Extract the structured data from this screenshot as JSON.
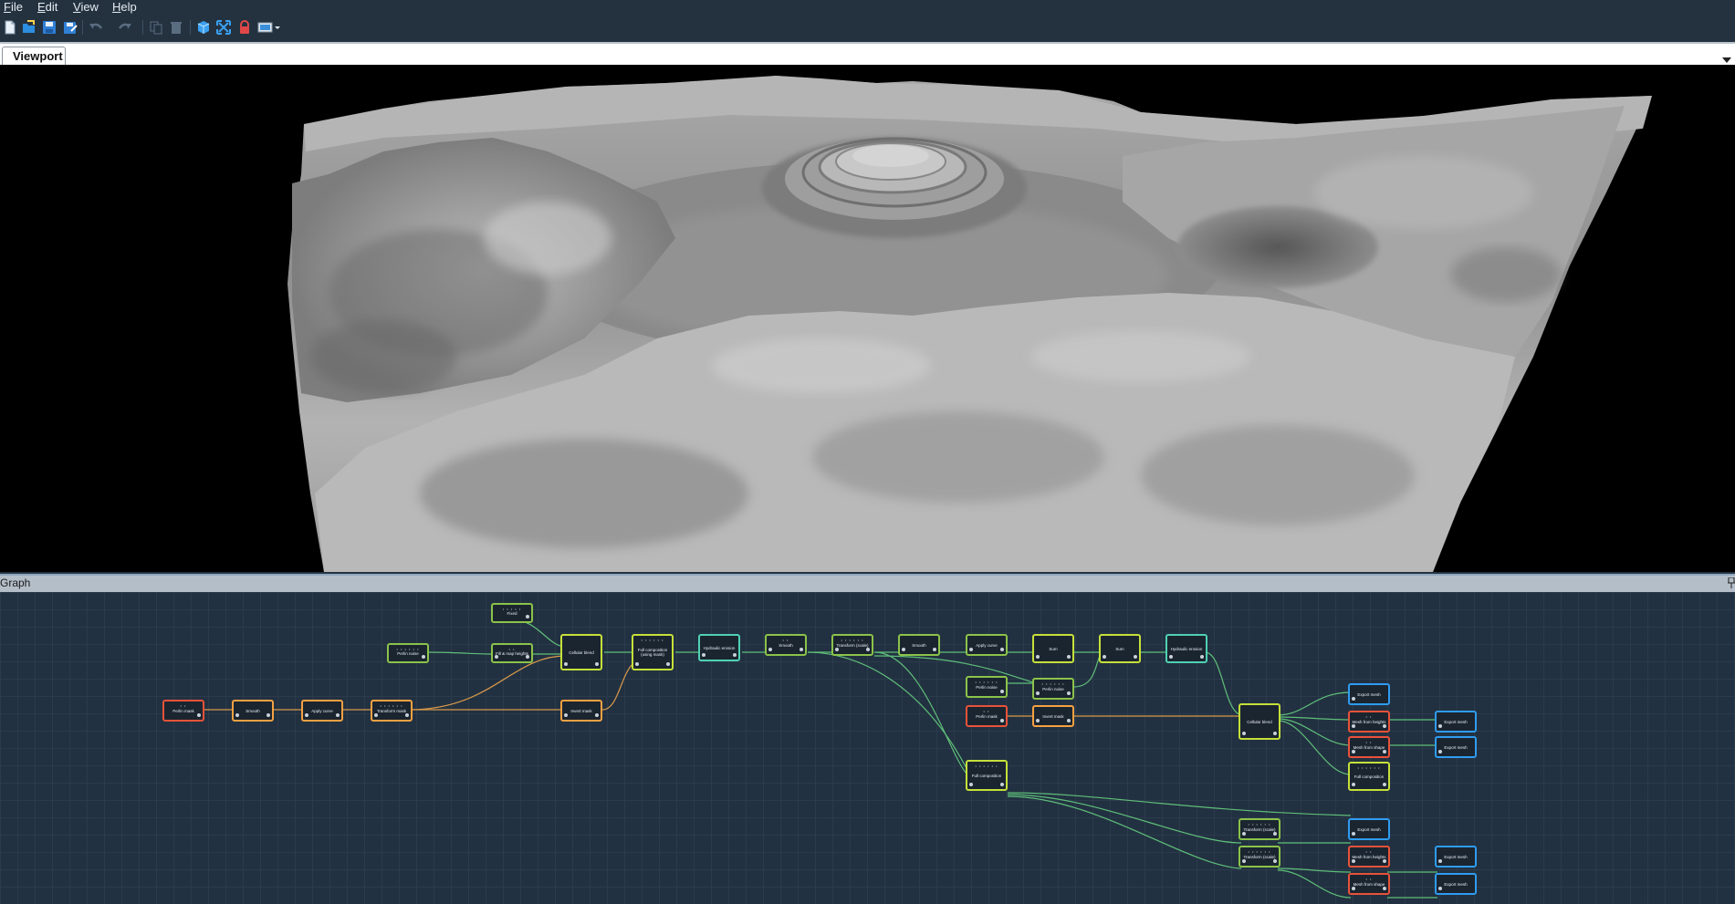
{
  "menu": [
    "File",
    "Edit",
    "View",
    "Help"
  ],
  "toolbar": {
    "icons": [
      "new-icon",
      "open-icon",
      "save-icon",
      "save-as-icon",
      "undo-icon",
      "redo-icon",
      "copy-icon",
      "delete-icon",
      "cube-icon",
      "fullscreen-icon",
      "lock-icon",
      "display-mode-icon"
    ]
  },
  "tabs": {
    "viewport_label": "Viewport"
  },
  "graph": {
    "title": "Graph"
  },
  "colors": {
    "green": "#8bc34a",
    "lime": "#c6e03a",
    "orange": "#f5a142",
    "red": "#e8523a",
    "teal": "#4fd1b4",
    "blue": "#2f9cf0"
  },
  "nodes": [
    {
      "id": "n1",
      "label": "Perlin noise",
      "color": "green",
      "pins": true
    },
    {
      "id": "n2",
      "label": "Fill & map heights",
      "color": "green",
      "pins": true
    },
    {
      "id": "n3",
      "label": "Fixed",
      "color": "green",
      "pins": true
    },
    {
      "id": "n4",
      "label": "Cellular blend",
      "color": "lime",
      "pins": false
    },
    {
      "id": "n5",
      "label": "Full composition (using mask)",
      "color": "lime",
      "pins": true
    },
    {
      "id": "n6",
      "label": "Hydraulic erosion",
      "color": "teal",
      "pins": false
    },
    {
      "id": "n7",
      "label": "Smooth",
      "color": "green",
      "pins": true
    },
    {
      "id": "n8",
      "label": "Transform (scale)",
      "color": "green",
      "pins": true
    },
    {
      "id": "n9",
      "label": "Smooth",
      "color": "green",
      "pins": false
    },
    {
      "id": "n10",
      "label": "Apply curve",
      "color": "green",
      "pins": false
    },
    {
      "id": "n11",
      "label": "Sum",
      "color": "lime",
      "pins": false
    },
    {
      "id": "n12",
      "label": "Sum",
      "color": "lime",
      "pins": false
    },
    {
      "id": "n13",
      "label": "Hydraulic erosion",
      "color": "teal",
      "pins": false
    },
    {
      "id": "n14",
      "label": "Perlin mask",
      "color": "red",
      "pins": true
    },
    {
      "id": "n15",
      "label": "Smooth",
      "color": "orange",
      "pins": false
    },
    {
      "id": "n16",
      "label": "Apply curve",
      "color": "orange",
      "pins": false
    },
    {
      "id": "n17",
      "label": "Transform mask",
      "color": "orange",
      "pins": true
    },
    {
      "id": "n18",
      "label": "Invert mask",
      "color": "orange",
      "pins": false
    },
    {
      "id": "n19",
      "label": "Perlin noise",
      "color": "green",
      "pins": true
    },
    {
      "id": "n20",
      "label": "Perlin noise",
      "color": "green",
      "pins": true
    },
    {
      "id": "n21",
      "label": "Perlin mask",
      "color": "red",
      "pins": true
    },
    {
      "id": "n22",
      "label": "Invert mask",
      "color": "orange",
      "pins": false
    },
    {
      "id": "n23",
      "label": "Full composition",
      "color": "lime",
      "pins": true
    },
    {
      "id": "n24",
      "label": "Cellular blend",
      "color": "lime",
      "pins": false
    },
    {
      "id": "n25",
      "label": "Export mesh",
      "color": "blue",
      "pins": false
    },
    {
      "id": "n26",
      "label": "Mesh from heights",
      "color": "red",
      "pins": true
    },
    {
      "id": "n27",
      "label": "Mesh from shape",
      "color": "red",
      "pins": true
    },
    {
      "id": "n28",
      "label": "Full composition",
      "color": "lime",
      "pins": true
    },
    {
      "id": "n29",
      "label": "Export mesh",
      "color": "blue",
      "pins": false
    },
    {
      "id": "n30",
      "label": "Export mesh",
      "color": "blue",
      "pins": false
    },
    {
      "id": "n31",
      "label": "Transform (scale)",
      "color": "green",
      "pins": true
    },
    {
      "id": "n32",
      "label": "Transform (scale)",
      "color": "green",
      "pins": true
    },
    {
      "id": "n33",
      "label": "Export mesh",
      "color": "blue",
      "pins": false
    },
    {
      "id": "n34",
      "label": "Mesh from heights",
      "color": "red",
      "pins": true
    },
    {
      "id": "n35",
      "label": "Mesh from shape",
      "color": "red",
      "pins": true
    },
    {
      "id": "n36",
      "label": "Export mesh",
      "color": "blue",
      "pins": false
    },
    {
      "id": "n37",
      "label": "Export mesh",
      "color": "blue",
      "pins": false
    }
  ]
}
